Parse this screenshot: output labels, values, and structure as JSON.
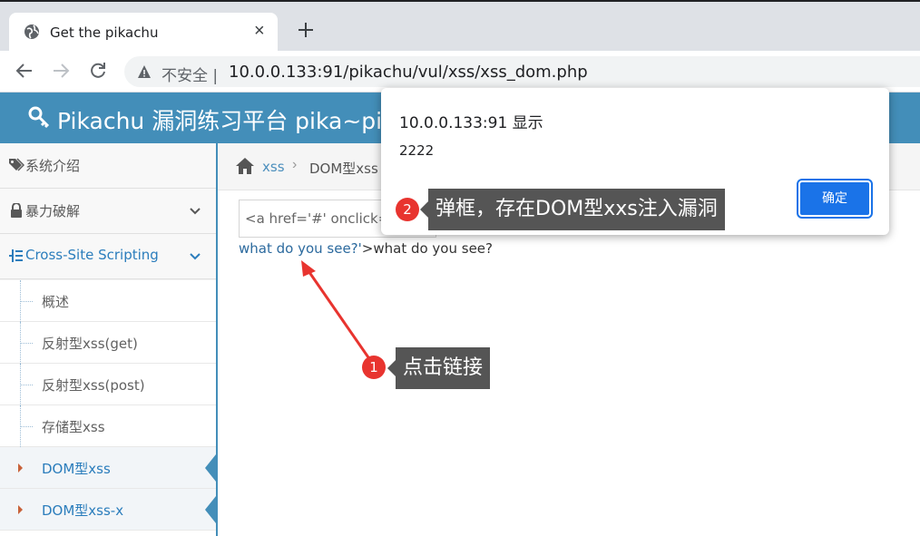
{
  "browser": {
    "tab_title": "Get the pikachu",
    "tab_close": "×",
    "security_label": "不安全",
    "url": "10.0.0.133:91/pikachu/vul/xss/xss_dom.php"
  },
  "site": {
    "title": "Pikachu 漏洞练习平台 pika~pika~",
    "accent_color": "#438eb9"
  },
  "sidebar": {
    "items": [
      {
        "label": "系统介绍",
        "icon": "tags-icon"
      },
      {
        "label": "暴力破解",
        "icon": "lock-icon"
      },
      {
        "label": "Cross-Site Scripting",
        "icon": "list-icon"
      }
    ],
    "subitems": [
      {
        "label": "概述"
      },
      {
        "label": "反射型xss(get)"
      },
      {
        "label": "反射型xss(post)"
      },
      {
        "label": "存储型xss"
      },
      {
        "label": "DOM型xss"
      },
      {
        "label": "DOM型xss-x"
      }
    ]
  },
  "breadcrumb": {
    "link": "xss",
    "separator": "›",
    "current": "DOM型xss"
  },
  "main": {
    "input_value": "<a href='#' onclick='alert(2222)'>",
    "result_link": "what do you see?'",
    "result_tail": ">what do you see?"
  },
  "dialog": {
    "title": "10.0.0.133:91 显示",
    "message": "2222",
    "ok_label": "确定"
  },
  "annotations": [
    {
      "number": "1",
      "text": "点击链接"
    },
    {
      "number": "2",
      "text": "弹框，存在DOM型xxs注入漏洞"
    }
  ]
}
